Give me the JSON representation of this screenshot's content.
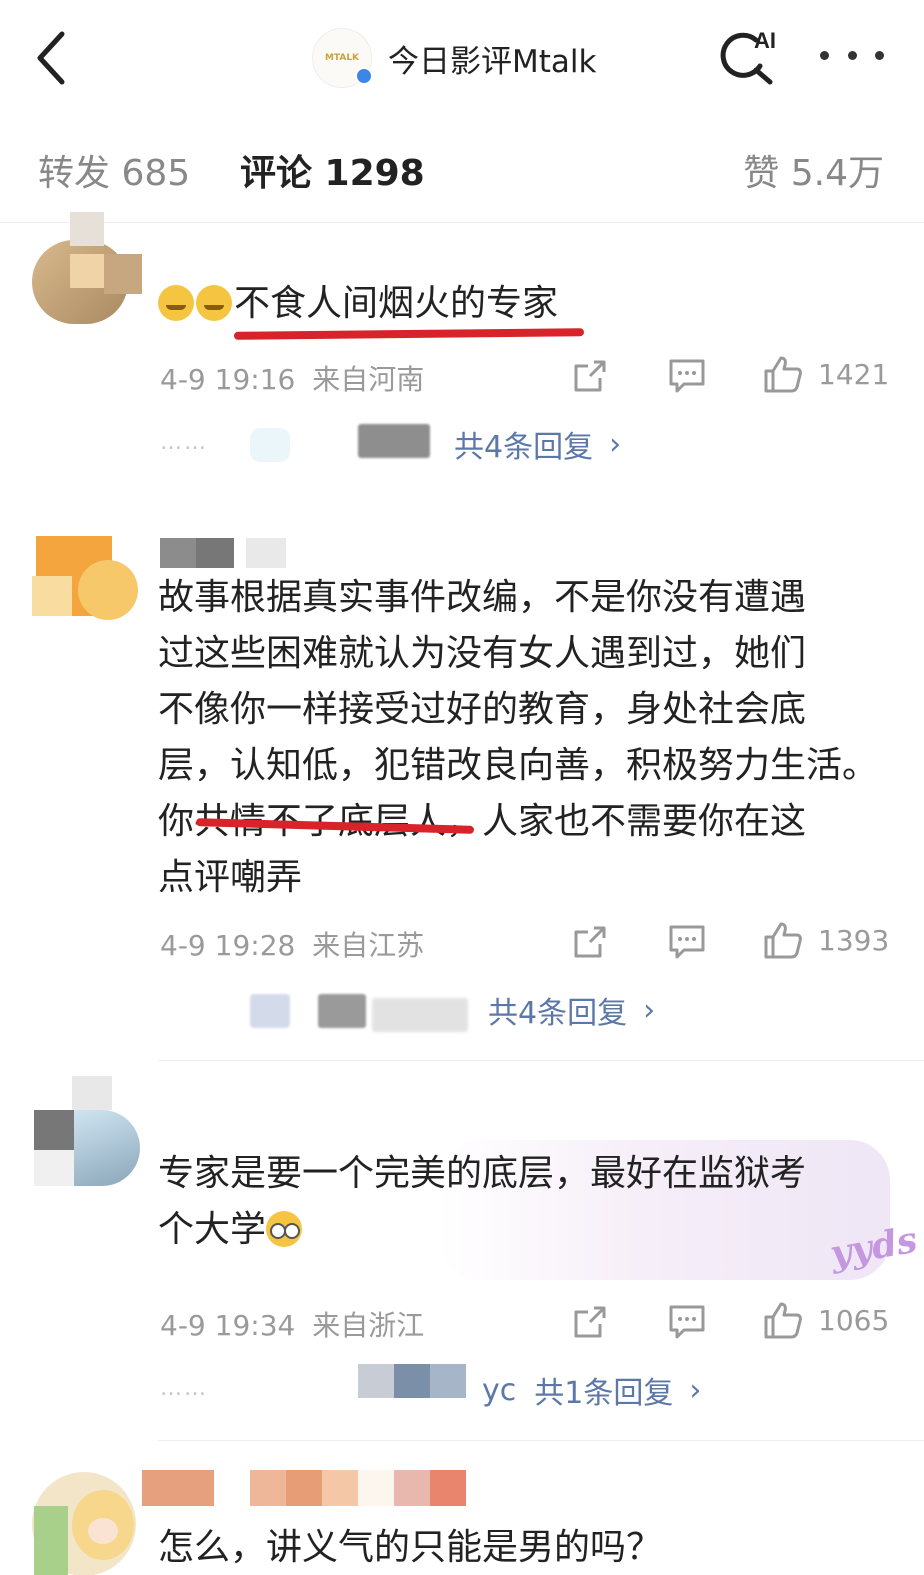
{
  "header": {
    "account_name": "今日影评Mtalk",
    "logo_text": "MTALK",
    "ai_label": "AI"
  },
  "tabs": {
    "repost": "转发 685",
    "comments": "评论 1298",
    "likes": "赞 5.4万"
  },
  "comments": [
    {
      "text": "不食人间烟火的专家",
      "time": "4-9 19:16",
      "location": "来自河南",
      "likes": "1421",
      "reply_summary": "共4条回复",
      "dots": "……"
    },
    {
      "lines": [
        "故事根据真实事件改编，不是你没有遭遇",
        "过这些困难就认为没有女人遇到过，她们",
        "不像你一样接受过好的教育，身处社会底",
        "层，认知低，犯错改良向善，积极努力生活。",
        "你共情不了底层人，人家也不需要你在这",
        "点评嘲弄"
      ],
      "time": "4-9 19:28",
      "location": "来自江苏",
      "likes": "1393",
      "reply_summary": "共4条回复"
    },
    {
      "lines": [
        "专家是要一个完美的底层，最好在监狱考",
        "个大学"
      ],
      "sticker": "yyds",
      "time": "4-9 19:34",
      "location": "来自浙江",
      "likes": "1065",
      "reply_prefix": "yc",
      "reply_summary": "共1条回复",
      "dots": "……"
    },
    {
      "text": "怎么，讲义气的只能是男的吗？"
    }
  ],
  "chevron": "›",
  "colors": {
    "underline": "#d8232a",
    "link": "#5b78a8",
    "muted": "#9a9a9a"
  },
  "icons": [
    "back-arrow-icon",
    "ai-search-icon",
    "more-dots-icon",
    "share-icon",
    "comment-icon",
    "thumbs-up-icon",
    "verified-badge-icon"
  ]
}
